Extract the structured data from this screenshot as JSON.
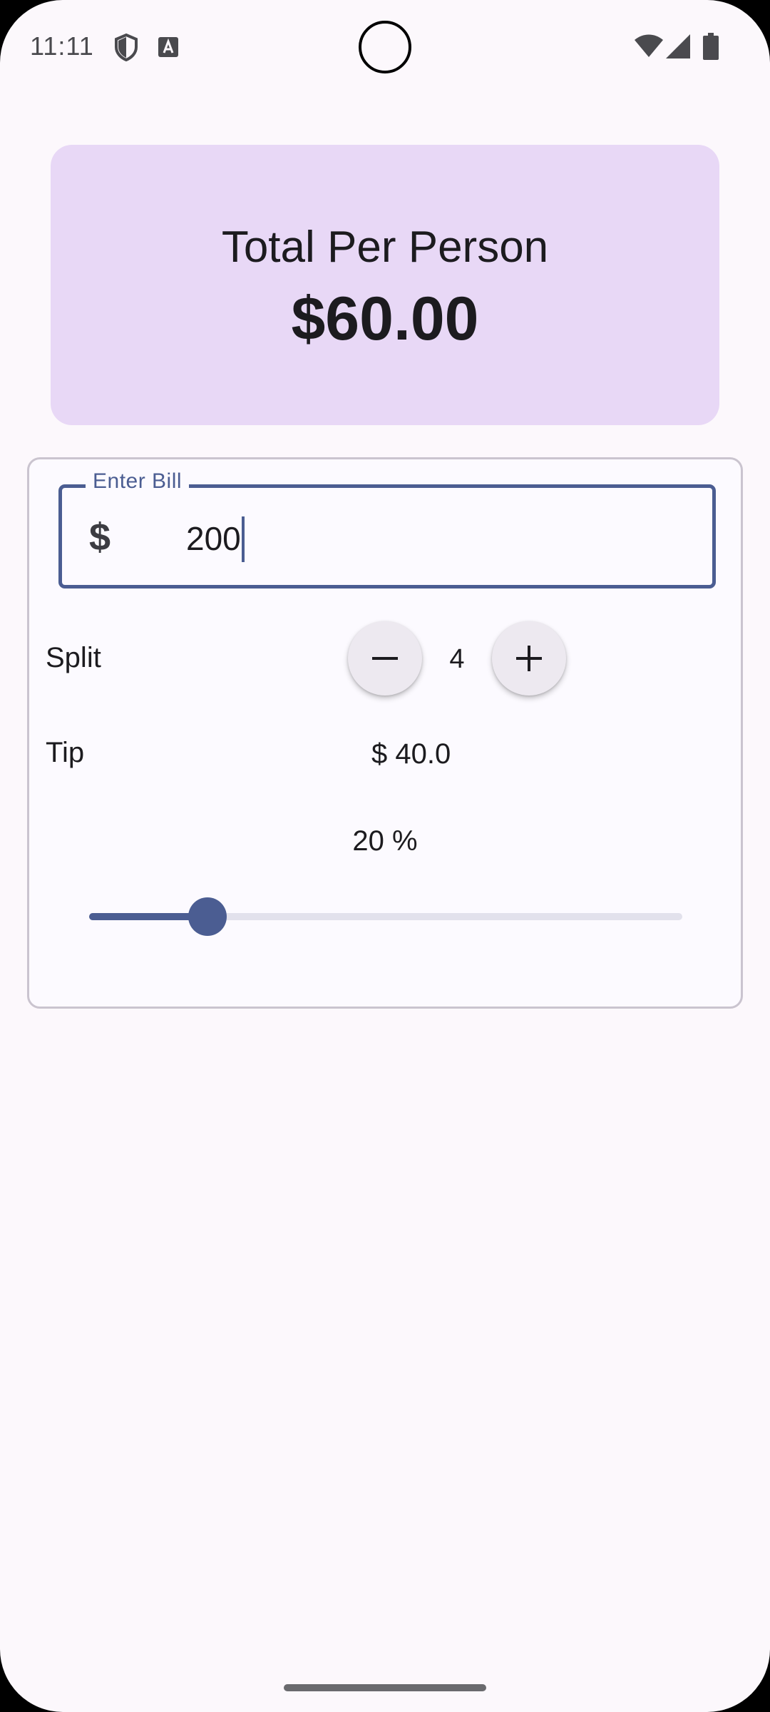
{
  "status_bar": {
    "time": "11:11"
  },
  "summary": {
    "label": "Total Per Person",
    "amount": "$60.00"
  },
  "bill": {
    "label": "Enter Bill",
    "currency_symbol": "$",
    "value": "200"
  },
  "split": {
    "label": "Split",
    "count": "4"
  },
  "tip": {
    "label": "Tip",
    "amount": "$ 40.0",
    "percent_text": "20 %",
    "percent_value": 20
  },
  "colors": {
    "primary": "#4b5d92",
    "card": "#e8d8f6",
    "background": "#fcf8fc"
  }
}
